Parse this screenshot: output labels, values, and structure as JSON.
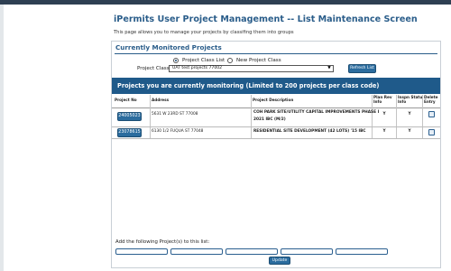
{
  "page": {
    "title": "iPermits User Project Management -- List Maintenance Screen",
    "subtitle": "This page allows you to manage your projects by classifing them into groups"
  },
  "monitored": {
    "section_title": "Currently Monitored Projects",
    "radio_class_list": "Project Class List",
    "radio_new_class": "New Project Class",
    "class_label": "Project Class:",
    "class_value": "UAT test projects 77002",
    "refresh_label": "Refresh List"
  },
  "list": {
    "header": "Projects you are currently monitoring (Limited to 200 projects per class code)",
    "columns": {
      "project_no": "Project No",
      "address": "Address",
      "description": "Project Description",
      "plan_rev_1": "Plan Rev",
      "plan_rev_2": "Info",
      "inspn_1": "Inspn Statu",
      "inspn_2": "Info",
      "delete_1": "Delete",
      "delete_2": "Entry"
    },
    "rows": [
      {
        "project_no": "24005023",
        "address": "5631 W 23RD ST 77008",
        "description_1": "COH PARK SITE/UTILITY CAPITAL IMPROVEMENTS PHASE I",
        "description_2": "2021 IBC (M/2)",
        "plan_rev": "Y",
        "inspn": "Y"
      },
      {
        "project_no": "23078615",
        "address": "6130 1/2 FUQUA ST 77048",
        "description_1": "RESIDENTIAL SITE DEVELOPMENT (42 LOTS) '15 IBC",
        "description_2": "",
        "plan_rev": "Y",
        "inspn": "Y"
      }
    ]
  },
  "add": {
    "label": "Add the following Project(s) to this list:",
    "update_label": "Update"
  },
  "colors": {
    "accent": "#2a5d8a",
    "header_bg": "#1f5a8a",
    "button_bg": "#2b6c9e"
  }
}
